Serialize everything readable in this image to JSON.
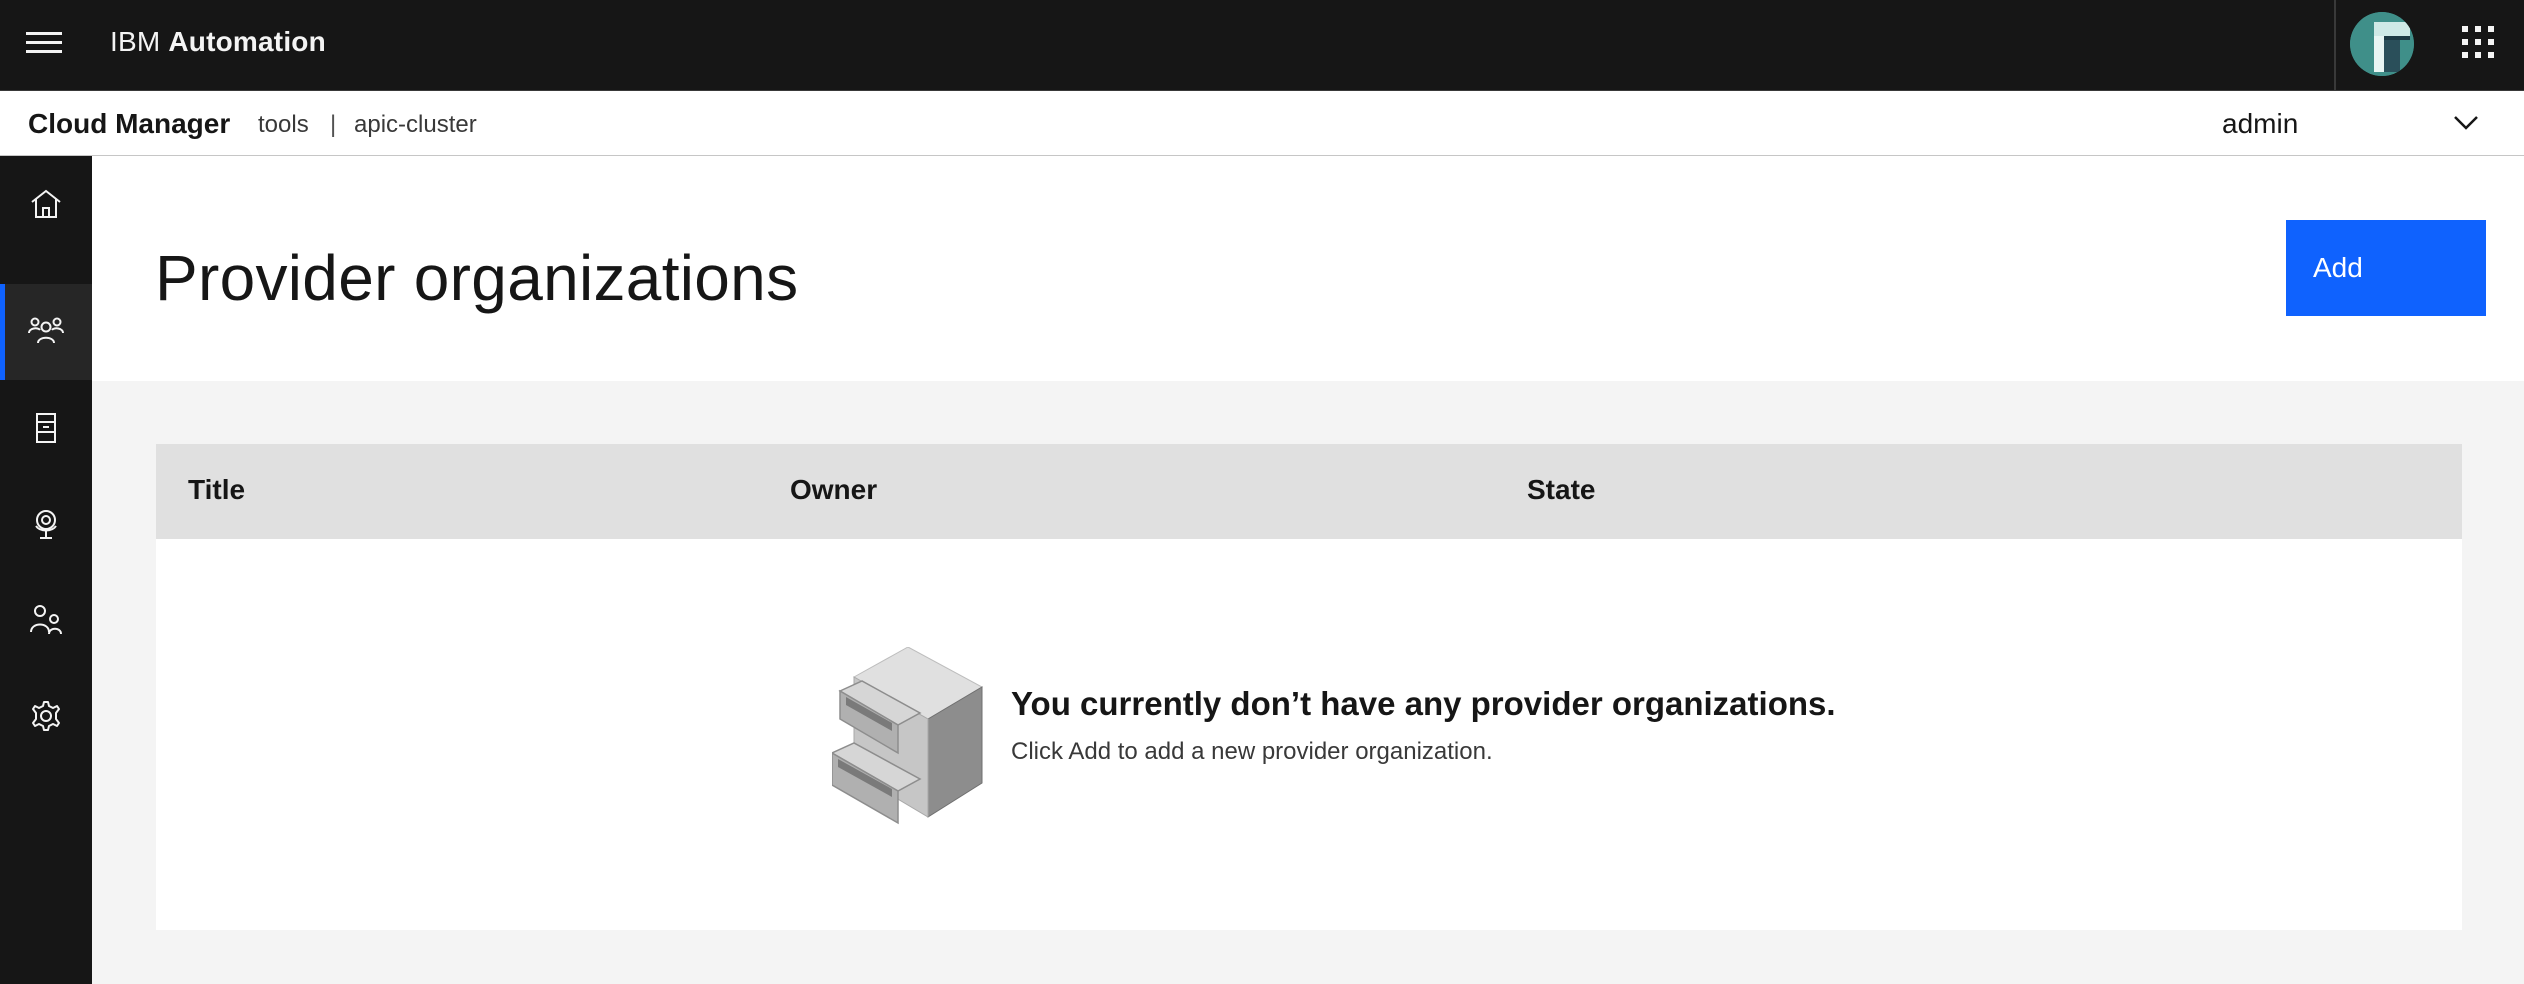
{
  "header": {
    "brand_prefix": "IBM",
    "brand_product": "Automation"
  },
  "subheader": {
    "app_name": "Cloud Manager",
    "breadcrumbs": [
      "tools",
      "apic-cluster"
    ],
    "separator": "|",
    "user": "admin"
  },
  "sidebar": {
    "items": [
      {
        "icon": "home-icon",
        "active": false
      },
      {
        "icon": "provider-organizations-icon",
        "active": true
      },
      {
        "icon": "resources-icon",
        "active": false
      },
      {
        "icon": "topology-icon",
        "active": false
      },
      {
        "icon": "members-icon",
        "active": false
      },
      {
        "icon": "settings-icon",
        "active": false
      }
    ]
  },
  "main": {
    "title": "Provider organizations",
    "add_label": "Add",
    "table": {
      "columns": [
        "Title",
        "Owner",
        "State"
      ],
      "rows": [],
      "empty_title": "You currently don’t have any provider organizations.",
      "empty_description": "Click Add to add a new provider organization."
    }
  },
  "colors": {
    "header_bg": "#161616",
    "accent": "#0f62fe",
    "page_bg": "#f4f4f4",
    "table_header_bg": "#e0e0e0"
  }
}
